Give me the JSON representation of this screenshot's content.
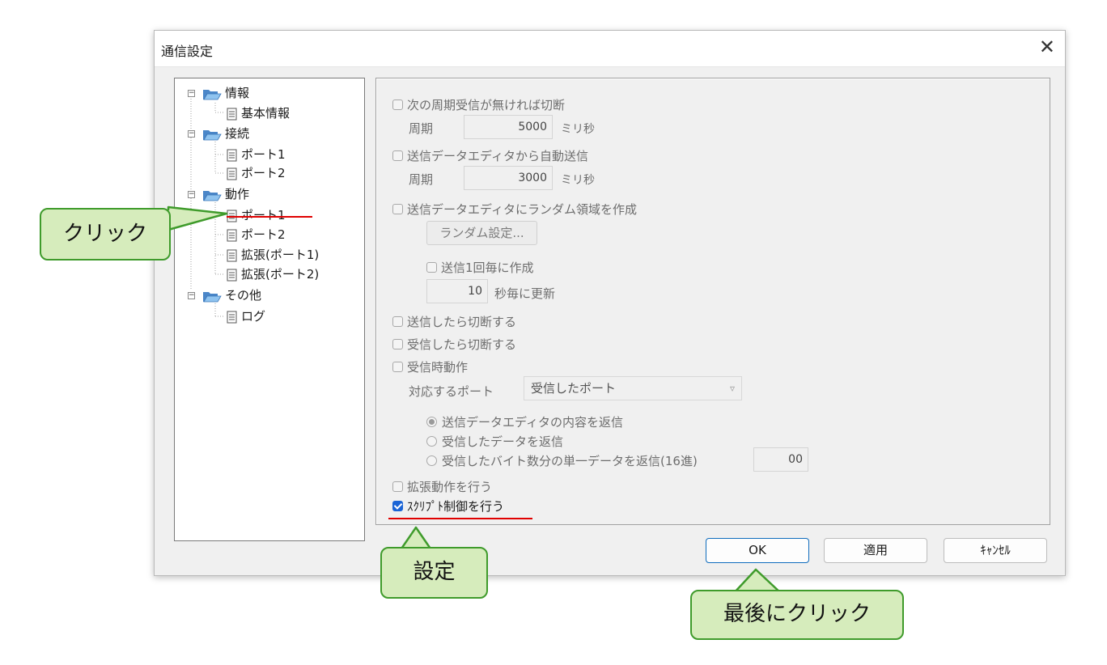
{
  "dialog": {
    "title": "通信設定",
    "close_label": "✕"
  },
  "tree": {
    "items": [
      {
        "label": "情報",
        "type": "folder"
      },
      {
        "label": "基本情報",
        "type": "page"
      },
      {
        "label": "接続",
        "type": "folder"
      },
      {
        "label": "ポート1",
        "type": "page"
      },
      {
        "label": "ポート2",
        "type": "page"
      },
      {
        "label": "動作",
        "type": "folder"
      },
      {
        "label": "ポート1",
        "type": "page",
        "selected": true
      },
      {
        "label": "ポート2",
        "type": "page"
      },
      {
        "label": "拡張(ポート1)",
        "type": "page"
      },
      {
        "label": "拡張(ポート2)",
        "type": "page"
      },
      {
        "label": "その他",
        "type": "folder"
      },
      {
        "label": "ログ",
        "type": "page"
      }
    ]
  },
  "settings": {
    "disconnect_no_periodic": "次の周期受信が無ければ切断",
    "period1_label": "周期",
    "period1_value": "5000",
    "period1_unit": "ミリ秒",
    "auto_send": "送信データエディタから自動送信",
    "period2_label": "周期",
    "period2_value": "3000",
    "period2_unit": "ミリ秒",
    "random_area": "送信データエディタにランダム領域を作成",
    "random_settings_button": "ランダム設定...",
    "create_each_send": "送信1回毎に作成",
    "update_seconds_value": "10",
    "update_seconds_unit": "秒毎に更新",
    "disconnect_after_send": "送信したら切断する",
    "disconnect_after_receive": "受信したら切断する",
    "receive_action": "受信時動作",
    "port_label": "対応するポート",
    "port_value": "受信したポート",
    "reply_editor": "送信データエディタの内容を返信",
    "reply_received": "受信したデータを返信",
    "reply_single": "受信したバイト数分の単一データを返信(16進)",
    "reply_single_value": "00",
    "extended_action": "拡張動作を行う",
    "script_control": "ｽｸﾘﾌﾟﾄ制御を行う"
  },
  "buttons": {
    "ok": "OK",
    "apply": "適用",
    "cancel": "ｷｬﾝｾﾙ"
  },
  "callouts": {
    "click": "クリック",
    "setting": "設定",
    "last_click": "最後にクリック"
  },
  "colors": {
    "callout_fill": "#d6ecbc",
    "callout_border": "#3f9b2b",
    "underline": "#e00000",
    "checkbox_on": "#1a64d6"
  }
}
